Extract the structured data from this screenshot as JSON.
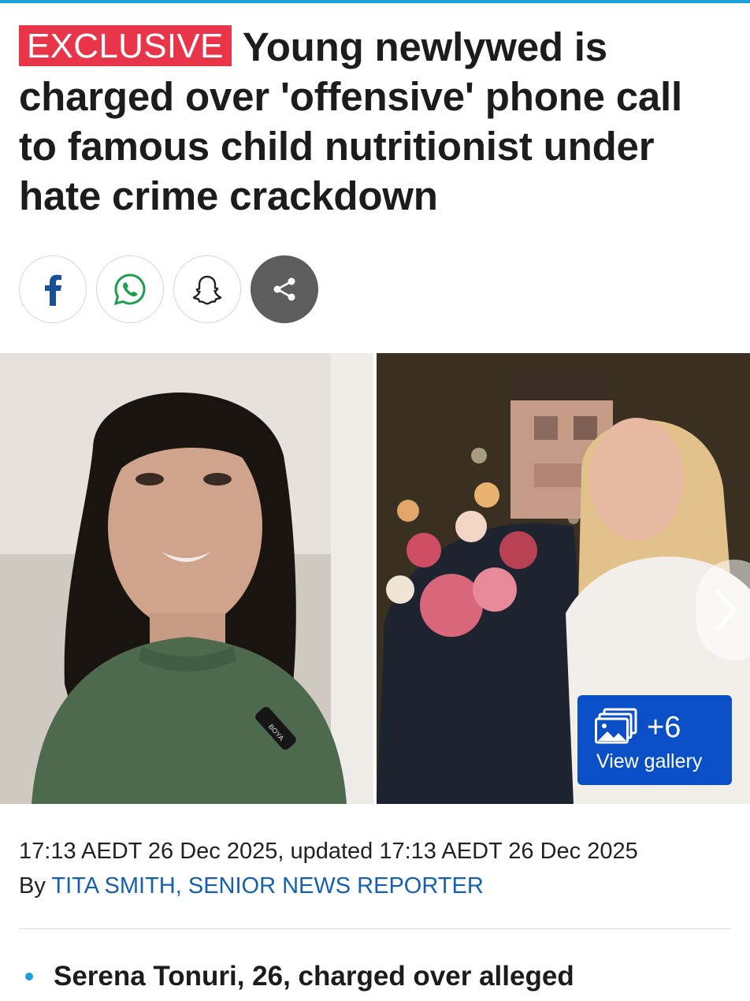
{
  "article": {
    "badge": "EXCLUSIVE",
    "headline": "Young newlywed is charged over 'offensive' phone call to famous child nutritionist under hate crime crackdown",
    "timestamp": "17:13 AEDT 26 Dec 2025, updated 17:13 AEDT 26 Dec 2025",
    "byline_prefix": "By",
    "author": "TITA SMITH, SENIOR NEWS REPORTER",
    "bullets": [
      "Serena Tonuri, 26, charged over alleged"
    ]
  },
  "share": {
    "buttons": [
      {
        "icon": "facebook-icon"
      },
      {
        "icon": "whatsapp-icon"
      },
      {
        "icon": "snapchat-icon"
      },
      {
        "icon": "share-icon"
      }
    ]
  },
  "gallery": {
    "count_label": "+6",
    "button_label": "View gallery",
    "mic_label": "BOYA"
  },
  "colors": {
    "accent": "#1aa0d6",
    "badge": "#e8354a",
    "gallery_button": "#0a4fc5",
    "author_link": "#1560b0"
  }
}
